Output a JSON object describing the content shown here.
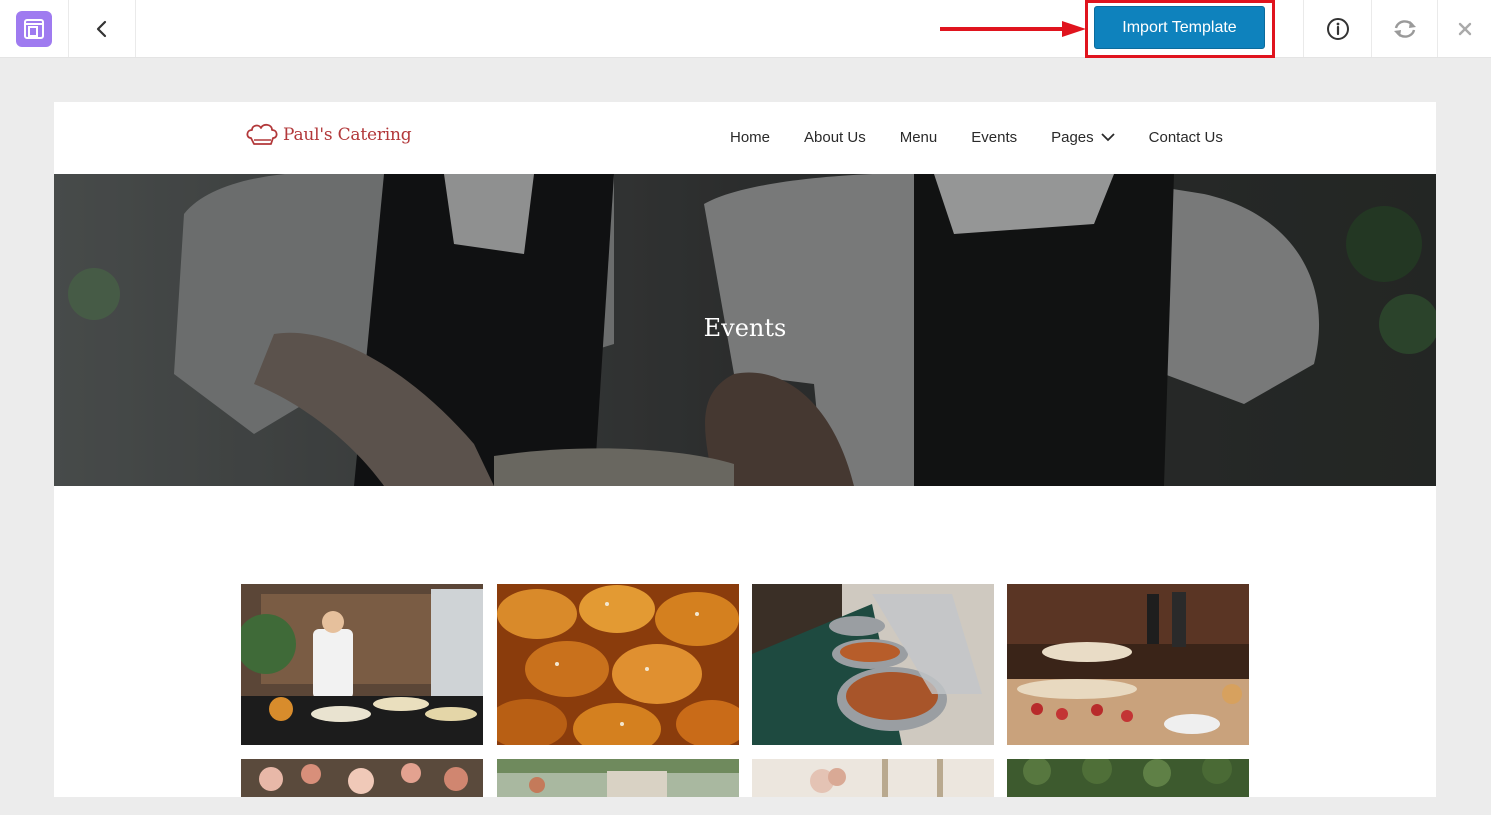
{
  "toolbar": {
    "logo_icon": "template-kit-icon",
    "back_icon": "chevron-left-icon",
    "import_label": "Import Template",
    "info_icon": "info-circle-icon",
    "sync_icon": "refresh-icon",
    "close_icon": "close-icon",
    "accent": "#0e82bd",
    "highlight_color": "#e0141e"
  },
  "site": {
    "brand": "Paul's Catering",
    "brand_color": "#b2383a",
    "nav": [
      {
        "label": "Home"
      },
      {
        "label": "About Us"
      },
      {
        "label": "Menu"
      },
      {
        "label": "Events"
      },
      {
        "label": "Pages"
      },
      {
        "label": "Contact Us"
      }
    ],
    "hero_title": "Events",
    "gallery": [
      {
        "alt": "chef buffet"
      },
      {
        "alt": "bread rolls"
      },
      {
        "alt": "chafing dishes"
      },
      {
        "alt": "dessert table"
      },
      {
        "alt": "flowers"
      },
      {
        "alt": "garden"
      },
      {
        "alt": "table decor"
      },
      {
        "alt": "hedge"
      }
    ]
  }
}
